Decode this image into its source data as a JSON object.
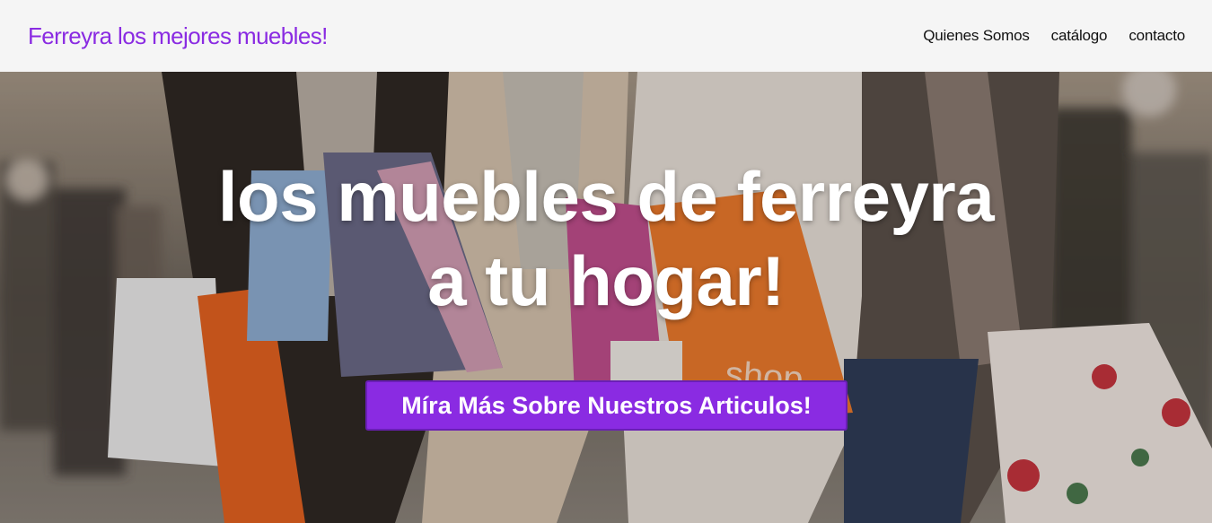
{
  "header": {
    "brand": "Ferreyra los mejores muebles!",
    "nav": [
      "Quienes Somos",
      "catálogo",
      "contacto"
    ]
  },
  "hero": {
    "title_line1": "los muebles de ferreyra",
    "title_line2": "a tu hogar!",
    "cta_label": "Míra Más Sobre Nuestros Articulos!",
    "bag_text": "shop"
  },
  "colors": {
    "brand": "#8a2be2",
    "nav_background": "#f5f5f5",
    "nav_text": "#111111",
    "hero_text": "#ffffff"
  }
}
